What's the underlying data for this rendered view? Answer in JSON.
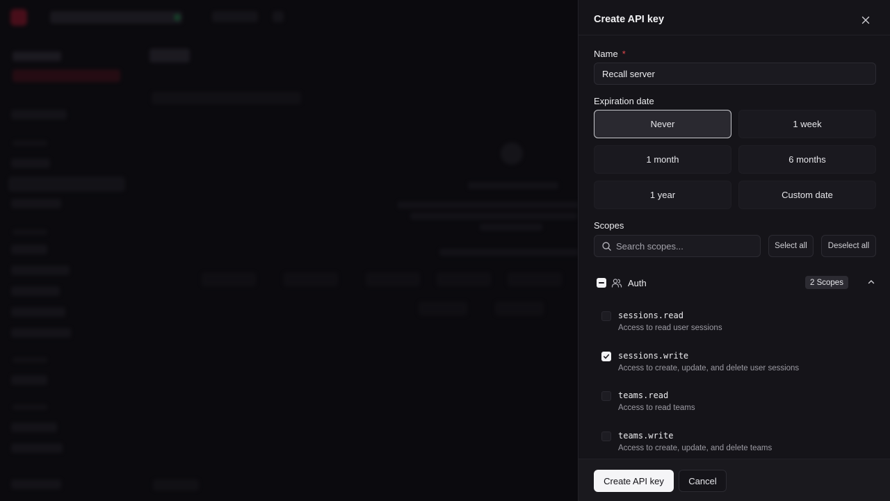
{
  "dialog": {
    "title": "Create API key",
    "name_label": "Name",
    "name_required_mark": "*",
    "name_value": "Recall server",
    "expiration_label": "Expiration date",
    "expiration_options": [
      "Never",
      "1 week",
      "1 month",
      "6 months",
      "1 year",
      "Custom date"
    ],
    "expiration_selected": "Never",
    "scopes_label": "Scopes",
    "search_placeholder": "Search scopes...",
    "select_all": "Select all",
    "deselect_all": "Deselect all",
    "group": {
      "name": "Auth",
      "badge": "2 Scopes",
      "state": "indeterminate"
    },
    "scopes": [
      {
        "name": "sessions.read",
        "description": "Access to read user sessions",
        "checked": false
      },
      {
        "name": "sessions.write",
        "description": "Access to create, update, and delete user sessions",
        "checked": true
      },
      {
        "name": "teams.read",
        "description": "Access to read teams",
        "checked": false
      },
      {
        "name": "teams.write",
        "description": "Access to create, update, and delete teams",
        "checked": false
      }
    ],
    "create_button": "Create API key",
    "cancel_button": "Cancel"
  },
  "icons": {
    "close": "close-icon",
    "search": "search-icon",
    "group": "users-icon",
    "collapse": "chevron-up-icon",
    "check": "check-icon"
  },
  "colors": {
    "drawer_bg": "#151419",
    "primary_button_bg": "#f5f5f7",
    "required": "#e5484d",
    "selected_border": "#c9c9ce"
  }
}
